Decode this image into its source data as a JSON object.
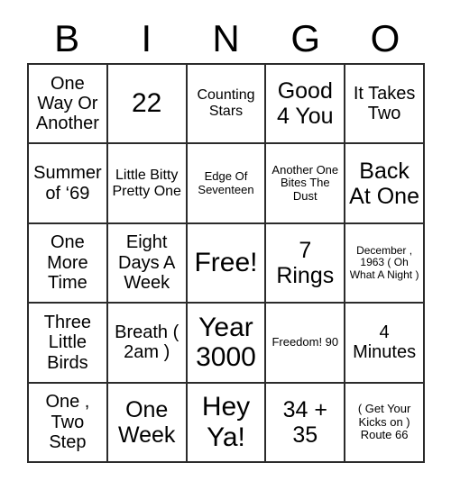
{
  "card": {
    "title_letters": [
      "B",
      "I",
      "N",
      "G",
      "O"
    ],
    "background_color": "#ffffff",
    "text_color": "#000000",
    "border_color": "#2b2b2b",
    "columns": 5,
    "rows": 5,
    "free_space_label": "Free!",
    "free_space_position": "center"
  },
  "cells": [
    {
      "text": "One Way Or Another",
      "size": "fs-md"
    },
    {
      "text": "22",
      "size": "fs-xl"
    },
    {
      "text": "Counting Stars",
      "size": "fs-sm"
    },
    {
      "text": "Good 4 You",
      "size": "fs-lg"
    },
    {
      "text": "It Takes Two",
      "size": "fs-md"
    },
    {
      "text": "Summer of ‘69",
      "size": "fs-md"
    },
    {
      "text": "Little Bitty Pretty One",
      "size": "fs-sm"
    },
    {
      "text": "Edge Of Seventeen",
      "size": "fs-xs"
    },
    {
      "text": "Another One Bites The Dust",
      "size": "fs-xs"
    },
    {
      "text": "Back At One",
      "size": "fs-lg"
    },
    {
      "text": "One More Time",
      "size": "fs-md"
    },
    {
      "text": "Eight Days A Week",
      "size": "fs-md"
    },
    {
      "text": "Free!",
      "size": "fs-xl"
    },
    {
      "text": "7 Rings",
      "size": "fs-lg"
    },
    {
      "text": "December , 1963 ( Oh What A Night )",
      "size": "fs-xxs"
    },
    {
      "text": "Three Little Birds",
      "size": "fs-md"
    },
    {
      "text": "Breath ( 2am )",
      "size": "fs-md"
    },
    {
      "text": "Year 3000",
      "size": "fs-xl"
    },
    {
      "text": "Freedom! 90",
      "size": "fs-xs"
    },
    {
      "text": "4 Minutes",
      "size": "fs-md"
    },
    {
      "text": "One , Two Step",
      "size": "fs-md"
    },
    {
      "text": "One Week",
      "size": "fs-lg"
    },
    {
      "text": "Hey Ya!",
      "size": "fs-xl"
    },
    {
      "text": "34 + 35",
      "size": "fs-lg"
    },
    {
      "text": "( Get Your Kicks on ) Route 66",
      "size": "fs-xs"
    }
  ]
}
